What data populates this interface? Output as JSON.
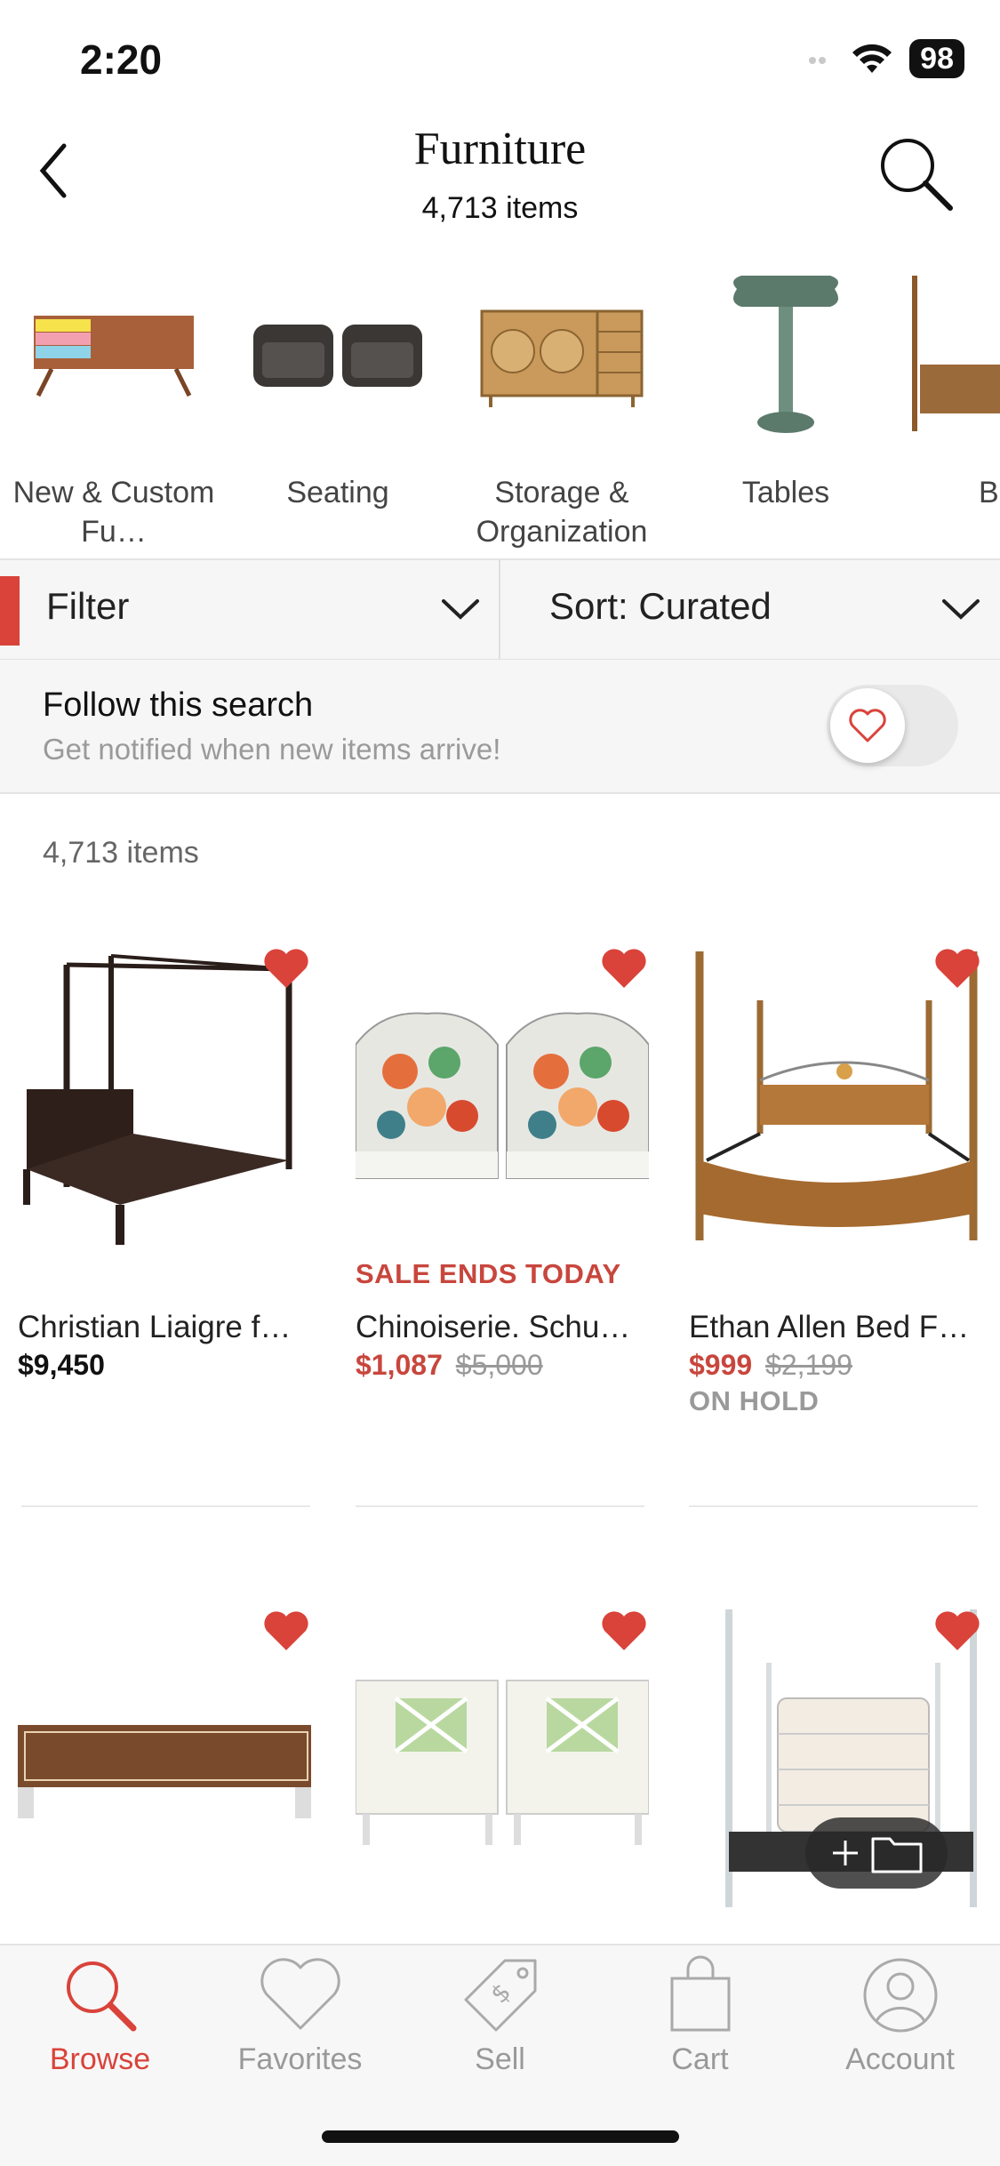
{
  "status_bar": {
    "time": "2:20",
    "battery": "98"
  },
  "header": {
    "title": "Furniture",
    "subtitle": "4,713 items"
  },
  "categories": [
    {
      "label": "New & Custom Fu…"
    },
    {
      "label": "Seating"
    },
    {
      "label": "Storage & Organization"
    },
    {
      "label": "Tables"
    },
    {
      "label": "Be"
    }
  ],
  "filter": {
    "label": "Filter"
  },
  "sort": {
    "label": "Sort: Curated"
  },
  "follow": {
    "title": "Follow this search",
    "subtitle": "Get notified when new items arrive!",
    "toggled": false
  },
  "results": {
    "count_label": "4,713 items"
  },
  "products": [
    {
      "sale_tag": "",
      "title": "Christian Liaigre f…",
      "price": "$9,450",
      "old_price": "",
      "status": "",
      "favorited": true
    },
    {
      "sale_tag": "SALE ENDS TODAY",
      "title": "Chinoiserie. Schu…",
      "price": "$1,087",
      "old_price": "$5,000",
      "status": "",
      "favorited": true
    },
    {
      "sale_tag": "",
      "title": "Ethan Allen Bed F…",
      "price": "$999",
      "old_price": "$2,199",
      "status": "ON HOLD",
      "favorited": true
    },
    {
      "favorited": true
    },
    {
      "favorited": true
    },
    {
      "favorited": true
    }
  ],
  "tabbar": {
    "browse": "Browse",
    "favorites": "Favorites",
    "sell": "Sell",
    "cart": "Cart",
    "account": "Account"
  },
  "colors": {
    "accent": "#d9433a",
    "sale": "#c8463d",
    "muted": "#999999"
  }
}
